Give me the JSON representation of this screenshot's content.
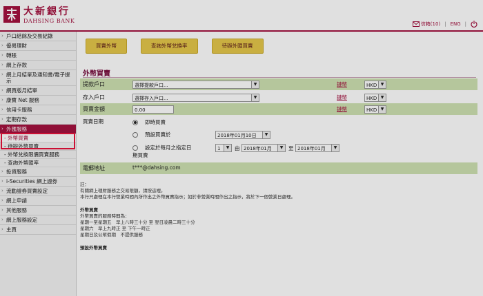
{
  "header": {
    "brand_cn": "大新銀行",
    "brand_en": "DAHSING BANK",
    "mailbox_label": "信箱(10)",
    "lang_en": "ENG",
    "sep": "|"
  },
  "sidebar": {
    "items": [
      {
        "label": "戶口結餘及交易紀錄"
      },
      {
        "label": "優易理財"
      },
      {
        "label": "轉賬"
      },
      {
        "label": "網上存款"
      },
      {
        "label": "網上月結單及通知書/電子提示"
      },
      {
        "label": "網頁版月結單"
      },
      {
        "label": "康寶 Net 服務"
      },
      {
        "label": "信用卡服務"
      },
      {
        "label": "定期存款"
      },
      {
        "label": "外匯服務",
        "active": true
      },
      {
        "label": "- 外幣買賣",
        "sub": true,
        "active": true
      },
      {
        "label": "- 待辦外幣買賣",
        "sub": true
      },
      {
        "label": "- 外幣兌換限價買賣服務",
        "sub": true
      },
      {
        "label": "- 查詢外幣匯率",
        "sub": true
      },
      {
        "label": "投資服務"
      },
      {
        "label": "i-Securities 網上證券"
      },
      {
        "label": "流動證券買賣設定"
      },
      {
        "label": "網上申請"
      },
      {
        "label": "其他服務"
      },
      {
        "label": "網上服務設定"
      },
      {
        "label": "主頁"
      }
    ]
  },
  "main": {
    "buttons": [
      "買賣外幣",
      "查詢外幣兌換率",
      "待辦外匯買賣"
    ],
    "title": "外幣買賣",
    "debit": {
      "label": "提款戶口",
      "value": "選擇提款戶口...",
      "link": "鏈幣",
      "currency": "HKD"
    },
    "credit": {
      "label": "存入戶口",
      "value": "選擇存入戶口...",
      "link": "鏈幣",
      "currency": "HKD"
    },
    "amount": {
      "label": "買賣金額",
      "value": "0.00",
      "link": "鏈幣",
      "currency": "HKD"
    },
    "date": {
      "label": "買賣日期",
      "opt1": "即時買賣",
      "opt2": "預設買賣於",
      "opt2_date": "2018年01月10日",
      "opt3": "設定於每月之指定日期買賣",
      "opt3_day": "1",
      "from_label": "由",
      "from": "2018年01月",
      "to_label": "至",
      "to": "2018年01月"
    },
    "email": {
      "label": "電郵地址",
      "value": "t***@dahsing.com"
    },
    "notes_title": "註：",
    "notes": [
      "有關網上理財服務之交易限額，請按這裡。",
      "本行只處理在本行營業時間內所作出之外幣買賣指示；如於非營業時間作出之指示，將於下一個營業日處理。",
      "外幣買賣",
      "外幣買賣的服務時間為：",
      "星期一至星期五　早上八時三十分 至 翌日凌晨二時三十分",
      "星期六　早上九時正 至 下午一時正",
      "星期日及公眾假期　不提供服務",
      "預設外幣買賣"
    ]
  }
}
